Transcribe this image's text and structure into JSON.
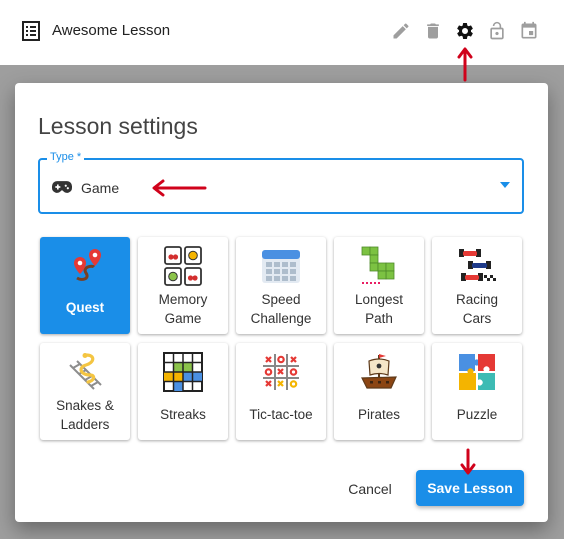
{
  "header": {
    "title": "Awesome Lesson",
    "icons": [
      "list-icon",
      "edit-icon",
      "delete-icon",
      "settings-icon",
      "lock-open-icon",
      "calendar-icon"
    ]
  },
  "dialog": {
    "title": "Lesson settings",
    "type_field": {
      "label": "Type",
      "required_mark": "*",
      "value": "Game",
      "icon": "gamepad-icon"
    },
    "games": [
      {
        "label_1": "Quest",
        "label_2": "",
        "icon": "map-route-icon",
        "selected": true
      },
      {
        "label_1": "Memory",
        "label_2": "Game",
        "icon": "memory-cards-icon",
        "selected": false
      },
      {
        "label_1": "Speed",
        "label_2": "Challenge",
        "icon": "calendar-grid-icon",
        "selected": false
      },
      {
        "label_1": "Longest",
        "label_2": "Path",
        "icon": "path-blocks-icon",
        "selected": false
      },
      {
        "label_1": "Racing",
        "label_2": "Cars",
        "icon": "race-cars-icon",
        "selected": false
      },
      {
        "label_1": "Snakes &",
        "label_2": "Ladders",
        "icon": "snake-ladder-icon",
        "selected": false
      },
      {
        "label_1": "Streaks",
        "label_2": "",
        "icon": "streak-grid-icon",
        "selected": false
      },
      {
        "label_1": "Tic-tac-toe",
        "label_2": "",
        "icon": "tic-tac-toe-icon",
        "selected": false
      },
      {
        "label_1": "Pirates",
        "label_2": "",
        "icon": "pirate-ship-icon",
        "selected": false
      },
      {
        "label_1": "Puzzle",
        "label_2": "",
        "icon": "puzzle-icon",
        "selected": false
      }
    ],
    "cancel_label": "Cancel",
    "save_label": "Save Lesson"
  },
  "colors": {
    "accent": "#1a8ee8",
    "annotation_arrow": "#d0021b",
    "backdrop": "#9e9e9e"
  }
}
